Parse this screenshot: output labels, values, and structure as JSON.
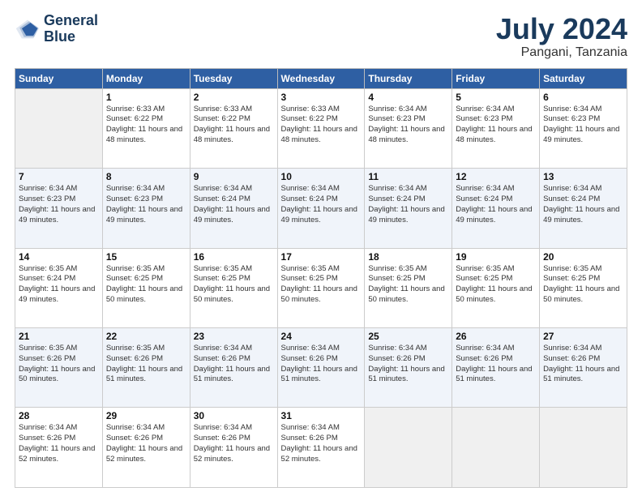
{
  "logo": {
    "line1": "General",
    "line2": "Blue"
  },
  "title": "July 2024",
  "subtitle": "Pangani, Tanzania",
  "days_of_week": [
    "Sunday",
    "Monday",
    "Tuesday",
    "Wednesday",
    "Thursday",
    "Friday",
    "Saturday"
  ],
  "weeks": [
    [
      {
        "day": "",
        "empty": true
      },
      {
        "day": "1",
        "sunrise": "Sunrise: 6:33 AM",
        "sunset": "Sunset: 6:22 PM",
        "daylight": "Daylight: 11 hours and 48 minutes."
      },
      {
        "day": "2",
        "sunrise": "Sunrise: 6:33 AM",
        "sunset": "Sunset: 6:22 PM",
        "daylight": "Daylight: 11 hours and 48 minutes."
      },
      {
        "day": "3",
        "sunrise": "Sunrise: 6:33 AM",
        "sunset": "Sunset: 6:22 PM",
        "daylight": "Daylight: 11 hours and 48 minutes."
      },
      {
        "day": "4",
        "sunrise": "Sunrise: 6:34 AM",
        "sunset": "Sunset: 6:23 PM",
        "daylight": "Daylight: 11 hours and 48 minutes."
      },
      {
        "day": "5",
        "sunrise": "Sunrise: 6:34 AM",
        "sunset": "Sunset: 6:23 PM",
        "daylight": "Daylight: 11 hours and 48 minutes."
      },
      {
        "day": "6",
        "sunrise": "Sunrise: 6:34 AM",
        "sunset": "Sunset: 6:23 PM",
        "daylight": "Daylight: 11 hours and 49 minutes."
      }
    ],
    [
      {
        "day": "7",
        "sunrise": "Sunrise: 6:34 AM",
        "sunset": "Sunset: 6:23 PM",
        "daylight": "Daylight: 11 hours and 49 minutes."
      },
      {
        "day": "8",
        "sunrise": "Sunrise: 6:34 AM",
        "sunset": "Sunset: 6:23 PM",
        "daylight": "Daylight: 11 hours and 49 minutes."
      },
      {
        "day": "9",
        "sunrise": "Sunrise: 6:34 AM",
        "sunset": "Sunset: 6:24 PM",
        "daylight": "Daylight: 11 hours and 49 minutes."
      },
      {
        "day": "10",
        "sunrise": "Sunrise: 6:34 AM",
        "sunset": "Sunset: 6:24 PM",
        "daylight": "Daylight: 11 hours and 49 minutes."
      },
      {
        "day": "11",
        "sunrise": "Sunrise: 6:34 AM",
        "sunset": "Sunset: 6:24 PM",
        "daylight": "Daylight: 11 hours and 49 minutes."
      },
      {
        "day": "12",
        "sunrise": "Sunrise: 6:34 AM",
        "sunset": "Sunset: 6:24 PM",
        "daylight": "Daylight: 11 hours and 49 minutes."
      },
      {
        "day": "13",
        "sunrise": "Sunrise: 6:34 AM",
        "sunset": "Sunset: 6:24 PM",
        "daylight": "Daylight: 11 hours and 49 minutes."
      }
    ],
    [
      {
        "day": "14",
        "sunrise": "Sunrise: 6:35 AM",
        "sunset": "Sunset: 6:24 PM",
        "daylight": "Daylight: 11 hours and 49 minutes."
      },
      {
        "day": "15",
        "sunrise": "Sunrise: 6:35 AM",
        "sunset": "Sunset: 6:25 PM",
        "daylight": "Daylight: 11 hours and 50 minutes."
      },
      {
        "day": "16",
        "sunrise": "Sunrise: 6:35 AM",
        "sunset": "Sunset: 6:25 PM",
        "daylight": "Daylight: 11 hours and 50 minutes."
      },
      {
        "day": "17",
        "sunrise": "Sunrise: 6:35 AM",
        "sunset": "Sunset: 6:25 PM",
        "daylight": "Daylight: 11 hours and 50 minutes."
      },
      {
        "day": "18",
        "sunrise": "Sunrise: 6:35 AM",
        "sunset": "Sunset: 6:25 PM",
        "daylight": "Daylight: 11 hours and 50 minutes."
      },
      {
        "day": "19",
        "sunrise": "Sunrise: 6:35 AM",
        "sunset": "Sunset: 6:25 PM",
        "daylight": "Daylight: 11 hours and 50 minutes."
      },
      {
        "day": "20",
        "sunrise": "Sunrise: 6:35 AM",
        "sunset": "Sunset: 6:25 PM",
        "daylight": "Daylight: 11 hours and 50 minutes."
      }
    ],
    [
      {
        "day": "21",
        "sunrise": "Sunrise: 6:35 AM",
        "sunset": "Sunset: 6:26 PM",
        "daylight": "Daylight: 11 hours and 50 minutes."
      },
      {
        "day": "22",
        "sunrise": "Sunrise: 6:35 AM",
        "sunset": "Sunset: 6:26 PM",
        "daylight": "Daylight: 11 hours and 51 minutes."
      },
      {
        "day": "23",
        "sunrise": "Sunrise: 6:34 AM",
        "sunset": "Sunset: 6:26 PM",
        "daylight": "Daylight: 11 hours and 51 minutes."
      },
      {
        "day": "24",
        "sunrise": "Sunrise: 6:34 AM",
        "sunset": "Sunset: 6:26 PM",
        "daylight": "Daylight: 11 hours and 51 minutes."
      },
      {
        "day": "25",
        "sunrise": "Sunrise: 6:34 AM",
        "sunset": "Sunset: 6:26 PM",
        "daylight": "Daylight: 11 hours and 51 minutes."
      },
      {
        "day": "26",
        "sunrise": "Sunrise: 6:34 AM",
        "sunset": "Sunset: 6:26 PM",
        "daylight": "Daylight: 11 hours and 51 minutes."
      },
      {
        "day": "27",
        "sunrise": "Sunrise: 6:34 AM",
        "sunset": "Sunset: 6:26 PM",
        "daylight": "Daylight: 11 hours and 51 minutes."
      }
    ],
    [
      {
        "day": "28",
        "sunrise": "Sunrise: 6:34 AM",
        "sunset": "Sunset: 6:26 PM",
        "daylight": "Daylight: 11 hours and 52 minutes."
      },
      {
        "day": "29",
        "sunrise": "Sunrise: 6:34 AM",
        "sunset": "Sunset: 6:26 PM",
        "daylight": "Daylight: 11 hours and 52 minutes."
      },
      {
        "day": "30",
        "sunrise": "Sunrise: 6:34 AM",
        "sunset": "Sunset: 6:26 PM",
        "daylight": "Daylight: 11 hours and 52 minutes."
      },
      {
        "day": "31",
        "sunrise": "Sunrise: 6:34 AM",
        "sunset": "Sunset: 6:26 PM",
        "daylight": "Daylight: 11 hours and 52 minutes."
      },
      {
        "day": "",
        "empty": true
      },
      {
        "day": "",
        "empty": true
      },
      {
        "day": "",
        "empty": true
      }
    ]
  ]
}
